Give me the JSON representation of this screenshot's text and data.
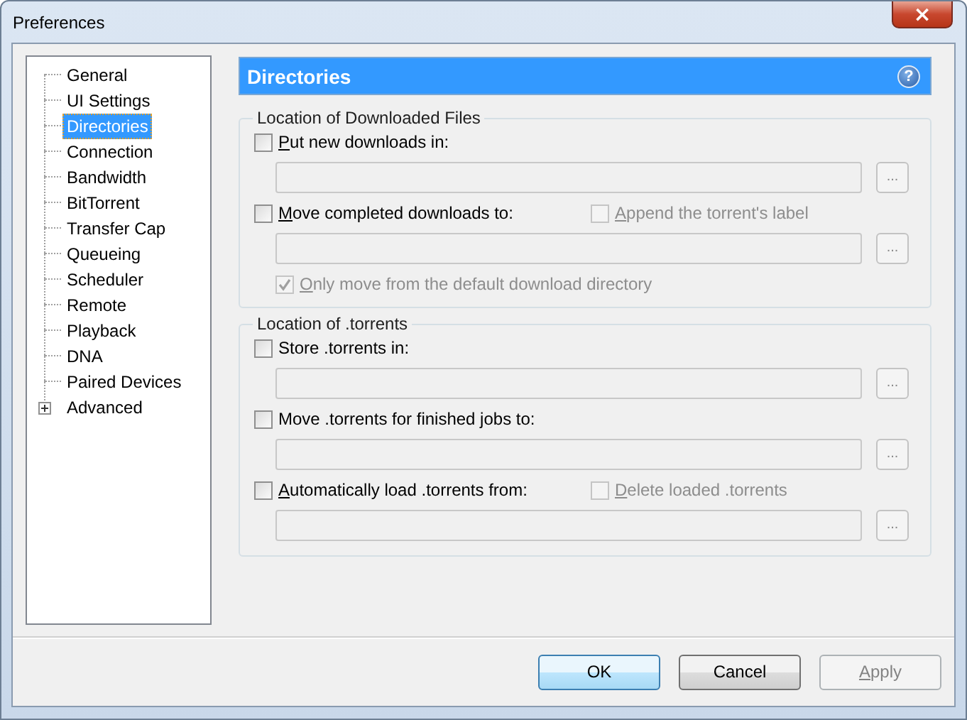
{
  "window": {
    "title": "Preferences",
    "close_button": "×"
  },
  "tree": [
    {
      "label": "General",
      "selected": false
    },
    {
      "label": "UI Settings",
      "selected": false
    },
    {
      "label": "Directories",
      "selected": true
    },
    {
      "label": "Connection",
      "selected": false
    },
    {
      "label": "Bandwidth",
      "selected": false
    },
    {
      "label": "BitTorrent",
      "selected": false
    },
    {
      "label": "Transfer Cap",
      "selected": false
    },
    {
      "label": "Queueing",
      "selected": false
    },
    {
      "label": "Scheduler",
      "selected": false
    },
    {
      "label": "Remote",
      "selected": false
    },
    {
      "label": "Playback",
      "selected": false
    },
    {
      "label": "DNA",
      "selected": false
    },
    {
      "label": "Paired Devices",
      "selected": false
    },
    {
      "label": "Advanced",
      "selected": false,
      "expandable": true,
      "expanded": false
    }
  ],
  "header": {
    "title": "Directories",
    "help": "?"
  },
  "sections": [
    {
      "title": "Location of Downloaded Files",
      "rows": [
        {
          "kind": "checkbox",
          "label": "Put new downloads in:",
          "mnemonic": true,
          "checked": false,
          "disabled": false
        },
        {
          "kind": "path",
          "browse": "...",
          "disabled": true
        },
        {
          "kind": "checkbox",
          "label": "Move completed downloads to:",
          "mnemonic": true,
          "checked": false,
          "disabled": false,
          "side": {
            "label": "Append the torrent's label",
            "mnemonic": true,
            "checked": false,
            "disabled": true
          }
        },
        {
          "kind": "path",
          "browse": "...",
          "disabled": true
        },
        {
          "kind": "subcheckbox",
          "label": "Only move from the default download directory",
          "mnemonic": true,
          "checked": true,
          "disabled": true
        }
      ]
    },
    {
      "title": "Location of .torrents",
      "rows": [
        {
          "kind": "checkbox",
          "label": "Store .torrents in:",
          "mnemonic": false,
          "checked": false,
          "disabled": false
        },
        {
          "kind": "path",
          "browse": "...",
          "disabled": true
        },
        {
          "kind": "checkbox",
          "label": "Move .torrents for finished jobs to:",
          "mnemonic": false,
          "checked": false,
          "disabled": false
        },
        {
          "kind": "path",
          "browse": "...",
          "disabled": true
        },
        {
          "kind": "checkbox",
          "label": "Automatically load .torrents from:",
          "mnemonic": true,
          "checked": false,
          "disabled": false,
          "side": {
            "label": "Delete loaded .torrents",
            "mnemonic": true,
            "checked": false,
            "disabled": true
          }
        },
        {
          "kind": "path",
          "browse": "...",
          "disabled": true
        }
      ]
    }
  ],
  "buttons": [
    {
      "label": "OK",
      "kind": "default",
      "disabled": false,
      "mnemonic": false
    },
    {
      "label": "Cancel",
      "kind": "normal",
      "disabled": false,
      "mnemonic": false
    },
    {
      "label": "Apply",
      "kind": "normal",
      "disabled": true,
      "mnemonic": true
    }
  ]
}
